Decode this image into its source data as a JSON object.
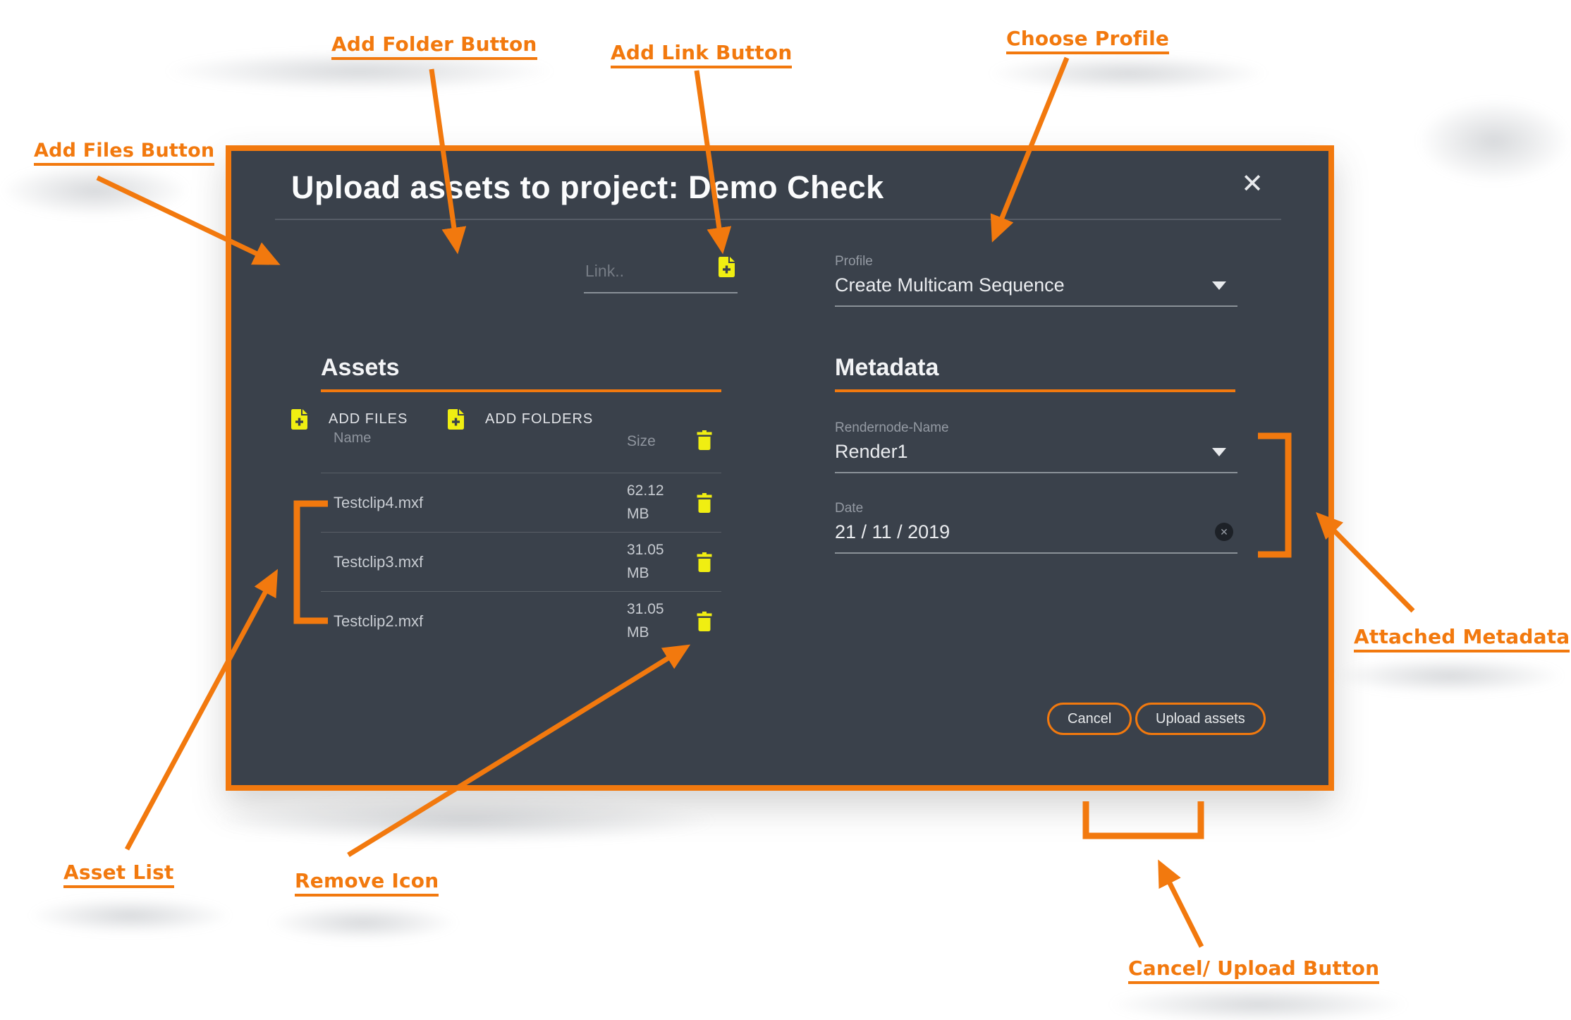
{
  "theme": {
    "accent_orange": "#F2790E",
    "icon_yellow": "#F0EE12",
    "modal_bg": "#3A414B",
    "text_light": "#EAECEF",
    "text_muted": "#949AA3"
  },
  "modal": {
    "title": "Upload assets to project: Demo Check",
    "icons": {
      "close": "✕",
      "clear": "✕"
    },
    "toolbar": {
      "add_files": "ADD FILES",
      "add_folders": "ADD FOLDERS",
      "link_placeholder": "Link.."
    },
    "profile": {
      "label": "Profile",
      "value": "Create Multicam Sequence"
    },
    "assets": {
      "heading": "Assets",
      "columns": {
        "name": "Name",
        "size": "Size"
      },
      "rows": [
        {
          "name": "Testclip4.mxf",
          "size_value": "62.12",
          "size_unit": "MB"
        },
        {
          "name": "Testclip3.mxf",
          "size_value": "31.05",
          "size_unit": "MB"
        },
        {
          "name": "Testclip2.mxf",
          "size_value": "31.05",
          "size_unit": "MB"
        }
      ]
    },
    "metadata": {
      "heading": "Metadata",
      "rendernode": {
        "label": "Rendernode-Name",
        "value": "Render1"
      },
      "date": {
        "label": "Date",
        "value": "21 / 11 / 2019"
      }
    },
    "actions": {
      "cancel": "Cancel",
      "upload": "Upload assets"
    }
  },
  "annotations": {
    "add_files": "Add Files Button",
    "add_folder": "Add Folder Button",
    "add_link": "Add Link Button",
    "choose_profile": "Choose Profile",
    "asset_list": "Asset List",
    "remove_icon": "Remove Icon",
    "attached_metadata": "Attached Metadata",
    "cancel_upload": "Cancel/ Upload Button"
  }
}
